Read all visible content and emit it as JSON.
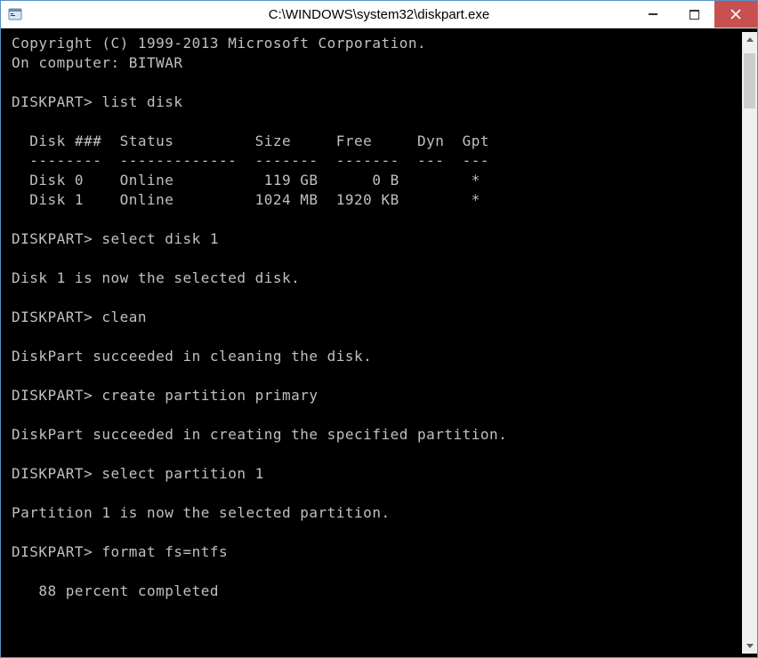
{
  "window": {
    "title": "C:\\WINDOWS\\system32\\diskpart.exe"
  },
  "terminal": {
    "lines": [
      "Copyright (C) 1999-2013 Microsoft Corporation.",
      "On computer: BITWAR",
      "",
      "DISKPART> list disk",
      "",
      "  Disk ###  Status         Size     Free     Dyn  Gpt",
      "  --------  -------------  -------  -------  ---  ---",
      "  Disk 0    Online          119 GB      0 B        *",
      "  Disk 1    Online         1024 MB  1920 KB        *",
      "",
      "DISKPART> select disk 1",
      "",
      "Disk 1 is now the selected disk.",
      "",
      "DISKPART> clean",
      "",
      "DiskPart succeeded in cleaning the disk.",
      "",
      "DISKPART> create partition primary",
      "",
      "DiskPart succeeded in creating the specified partition.",
      "",
      "DISKPART> select partition 1",
      "",
      "Partition 1 is now the selected partition.",
      "",
      "DISKPART> format fs=ntfs",
      "",
      "   88 percent completed"
    ]
  },
  "disk_table": {
    "headers": [
      "Disk ###",
      "Status",
      "Size",
      "Free",
      "Dyn",
      "Gpt"
    ],
    "rows": [
      {
        "id": "Disk 0",
        "status": "Online",
        "size": "119 GB",
        "free": "0 B",
        "dyn": "",
        "gpt": "*"
      },
      {
        "id": "Disk 1",
        "status": "Online",
        "size": "1024 MB",
        "free": "1920 KB",
        "dyn": "",
        "gpt": "*"
      }
    ]
  },
  "commands": [
    {
      "prompt": "DISKPART>",
      "cmd": "list disk"
    },
    {
      "prompt": "DISKPART>",
      "cmd": "select disk 1",
      "response": "Disk 1 is now the selected disk."
    },
    {
      "prompt": "DISKPART>",
      "cmd": "clean",
      "response": "DiskPart succeeded in cleaning the disk."
    },
    {
      "prompt": "DISKPART>",
      "cmd": "create partition primary",
      "response": "DiskPart succeeded in creating the specified partition."
    },
    {
      "prompt": "DISKPART>",
      "cmd": "select partition 1",
      "response": "Partition 1 is now the selected partition."
    },
    {
      "prompt": "DISKPART>",
      "cmd": "format fs=ntfs",
      "progress": "88 percent completed"
    }
  ],
  "copyright": "Copyright (C) 1999-2013 Microsoft Corporation.",
  "computer": "BITWAR"
}
